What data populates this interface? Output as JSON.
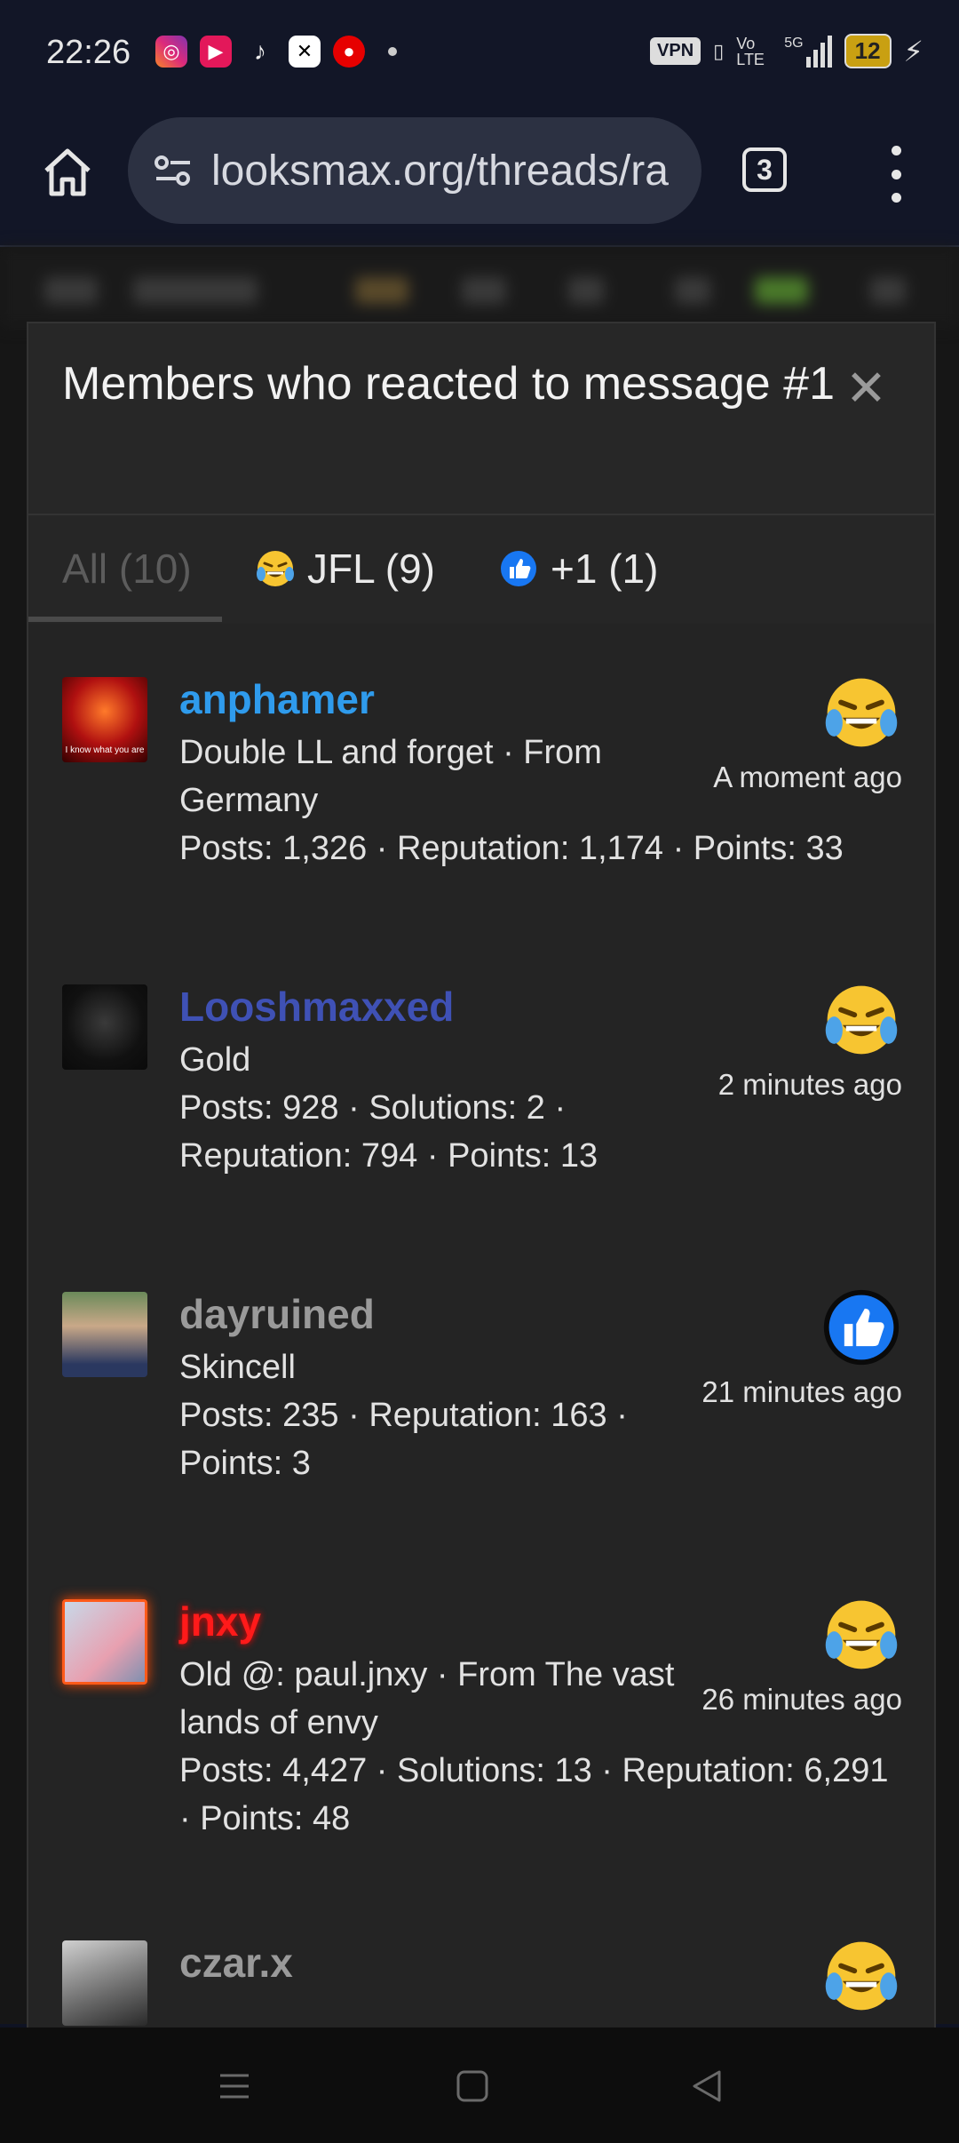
{
  "status": {
    "time": "22:26",
    "vpn": "VPN",
    "network": "Vo LTE",
    "signal": "5G",
    "battery": "12"
  },
  "browser": {
    "url": "looksmax.org/threads/ra",
    "tab_count": "3"
  },
  "modal": {
    "title": "Members who reacted to message #1",
    "tabs": [
      {
        "label": "All (10)"
      },
      {
        "label": "JFL (9)"
      },
      {
        "label": "+1 (1)"
      }
    ],
    "members": [
      {
        "name": "anphamer",
        "name_color": "#2f9bec",
        "title": "Double LL and forget · From Germany",
        "stats": "Posts: 1,326 · Reputation: 1,174 · Points: 33",
        "time": "A moment ago",
        "reaction": "jfl-emoji"
      },
      {
        "name": "Looshmaxxed",
        "name_color": "#3f51b5",
        "title": "Gold",
        "stats": "Posts: 928 · Solutions: 2 · Reputation: 794 · Points: 13",
        "time": "2 minutes ago",
        "reaction": "jfl-emoji"
      },
      {
        "name": "dayruined",
        "name_color": "#9a9a9a",
        "title": "Skincell",
        "stats": "Posts: 235 · Reputation: 163 · Points: 3",
        "time": "21 minutes ago",
        "reaction": "thumbs-up"
      },
      {
        "name": "jnxy",
        "name_color": "#ff1a1a",
        "title": "Old @: paul.jnxy · From The vast lands of envy",
        "stats": "Posts: 4,427 · Solutions: 13 · Reputation: 6,291 · Points: 48",
        "time": "26 minutes ago",
        "reaction": "jfl-emoji"
      },
      {
        "name": "czar.x",
        "name_color": "#9a9a9a",
        "title": "",
        "stats": "",
        "time": "",
        "reaction": "jfl-emoji"
      }
    ]
  }
}
